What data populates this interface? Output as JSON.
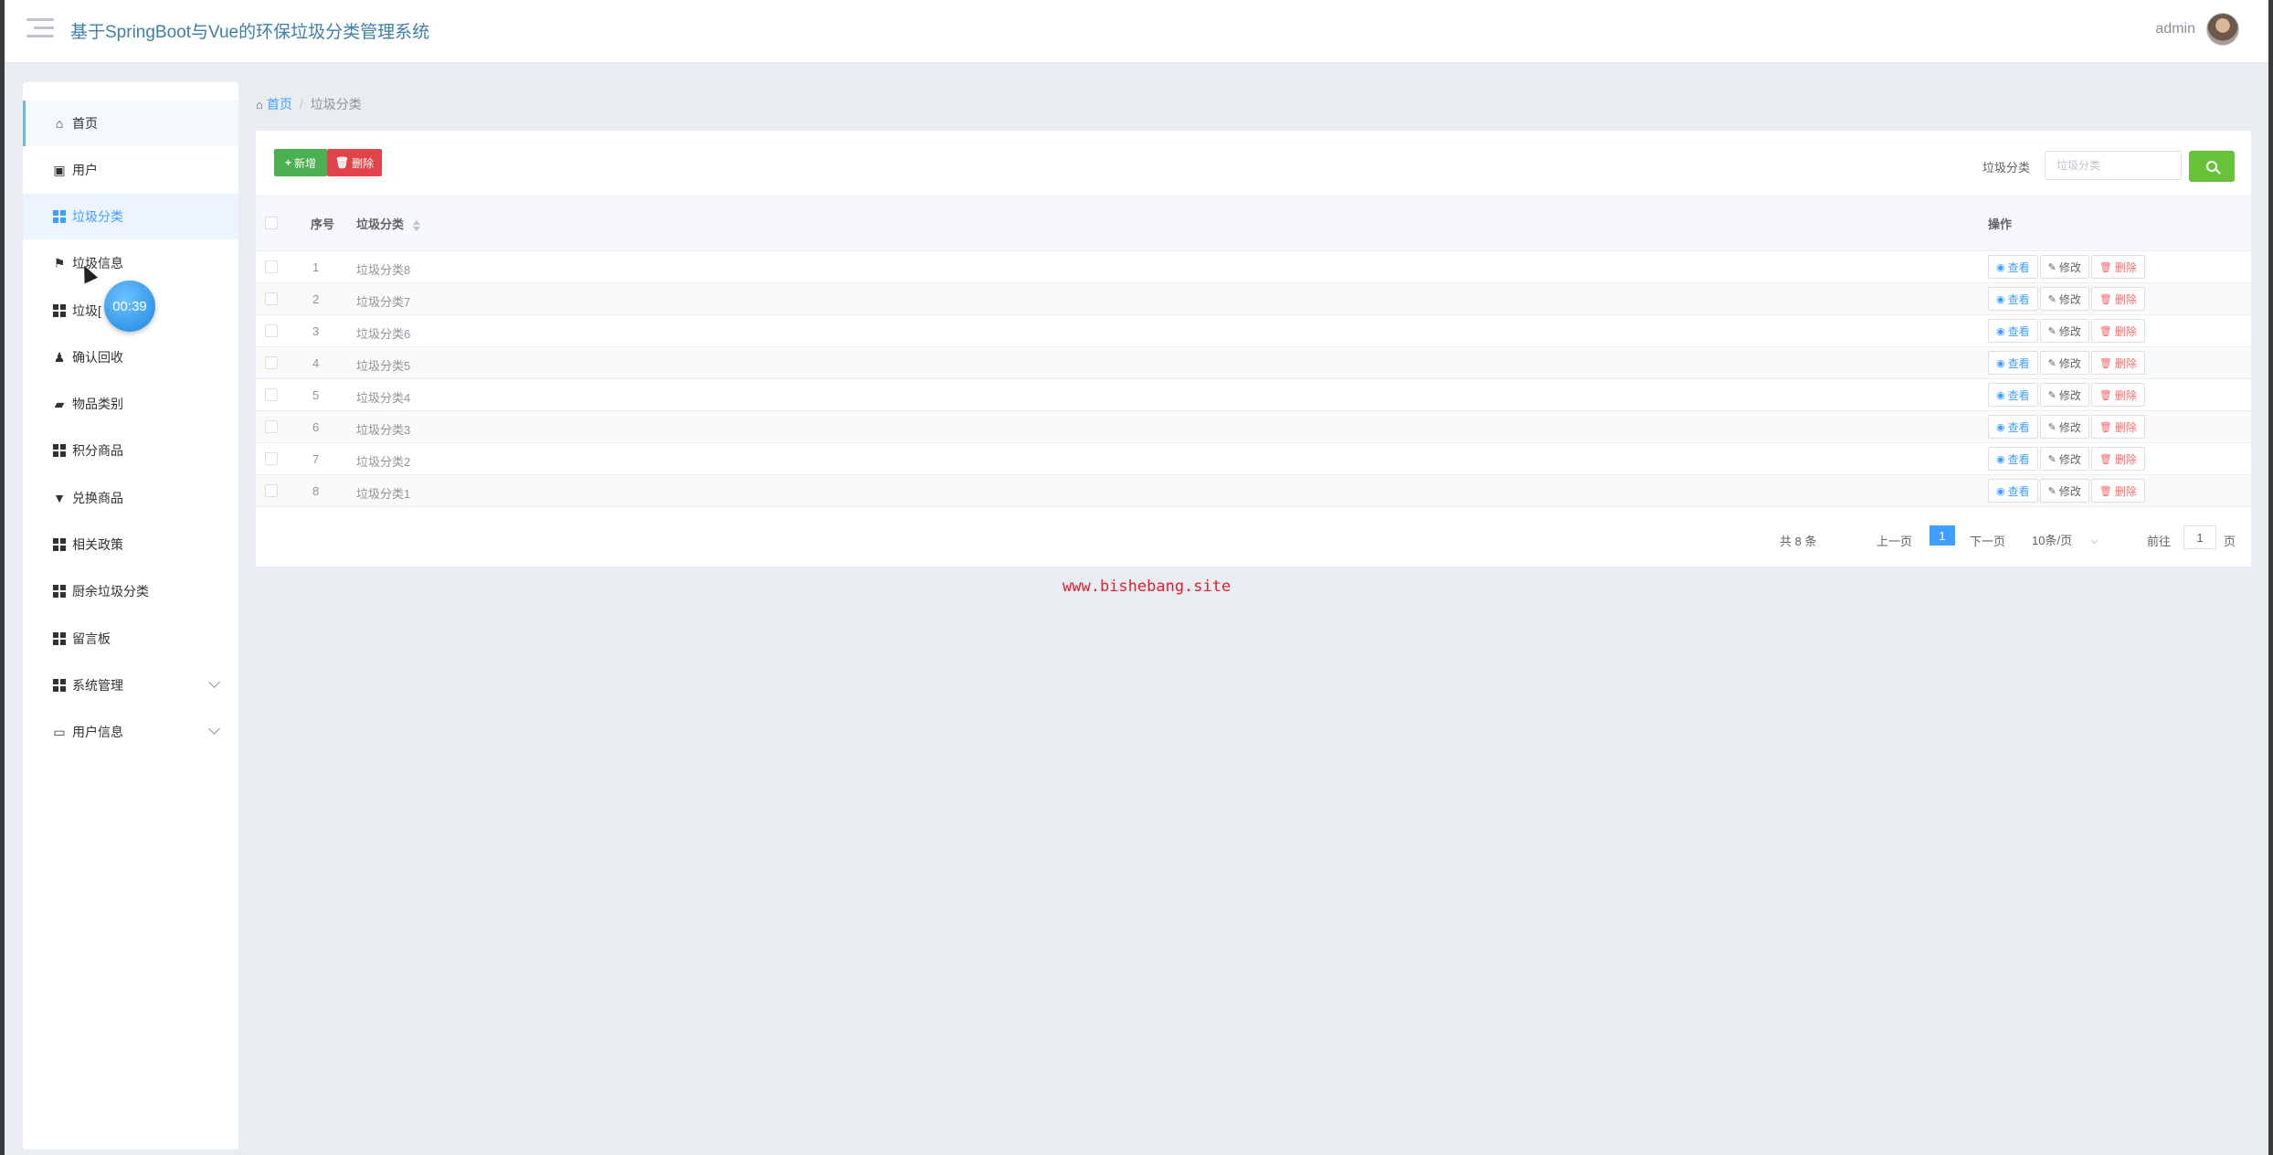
{
  "header": {
    "title": "基于SpringBoot与Vue的环保垃圾分类管理系统",
    "username": "admin",
    "menu_icon": "hamburger-menu-icon",
    "avatar_icon": "avatar"
  },
  "sidebar": {
    "items": [
      {
        "label": "首页",
        "icon": "home-icon"
      },
      {
        "label": "用户",
        "icon": "user-icon"
      },
      {
        "label": "垃圾分类",
        "icon": "grid-icon"
      },
      {
        "label": "垃圾信息",
        "icon": "flag-icon"
      },
      {
        "label": "垃圾[",
        "icon": "grid-icon"
      },
      {
        "label": "确认回收",
        "icon": "person-icon"
      },
      {
        "label": "物品类别",
        "icon": "ticket-icon"
      },
      {
        "label": "积分商品",
        "icon": "grid-icon"
      },
      {
        "label": "兑换商品",
        "icon": "stamp-icon"
      },
      {
        "label": "相关政策",
        "icon": "grid-icon"
      },
      {
        "label": "厨余垃圾分类",
        "icon": "grid-icon"
      },
      {
        "label": "留言板",
        "icon": "grid-icon"
      },
      {
        "label": "系统管理",
        "icon": "grid-icon"
      },
      {
        "label": "用户信息",
        "icon": "card-icon"
      }
    ],
    "timer": "00:39"
  },
  "breadcrumb": {
    "home": "首页",
    "separator": "/",
    "current": "垃圾分类"
  },
  "toolbar": {
    "add_label": "新增",
    "delete_label": "删除",
    "search_label": "垃圾分类",
    "search_placeholder": "垃圾分类",
    "search_value": ""
  },
  "table": {
    "columns": {
      "index": "序号",
      "category": "垃圾分类",
      "actions": "操作"
    },
    "rows": [
      {
        "index": "1",
        "category": "垃圾分类8"
      },
      {
        "index": "2",
        "category": "垃圾分类7"
      },
      {
        "index": "3",
        "category": "垃圾分类6"
      },
      {
        "index": "4",
        "category": "垃圾分类5"
      },
      {
        "index": "5",
        "category": "垃圾分类4"
      },
      {
        "index": "6",
        "category": "垃圾分类3"
      },
      {
        "index": "7",
        "category": "垃圾分类2"
      },
      {
        "index": "8",
        "category": "垃圾分类1"
      }
    ],
    "actions": {
      "view": "查看",
      "edit": "修改",
      "delete": "删除"
    }
  },
  "pagination": {
    "total": "共 8 条",
    "prev": "上一页",
    "current_page": "1",
    "next": "下一页",
    "page_size": "10条/页",
    "goto": "前往",
    "jump_value": "1",
    "page_suffix": "页"
  },
  "watermark": "www.bishebang.site",
  "colors": {
    "accent": "#409eff",
    "add_button": "#4caf50",
    "delete_button": "#e0444b",
    "search_button": "#67c23a",
    "title": "#3d7fa8",
    "watermark": "#e01e2c"
  }
}
